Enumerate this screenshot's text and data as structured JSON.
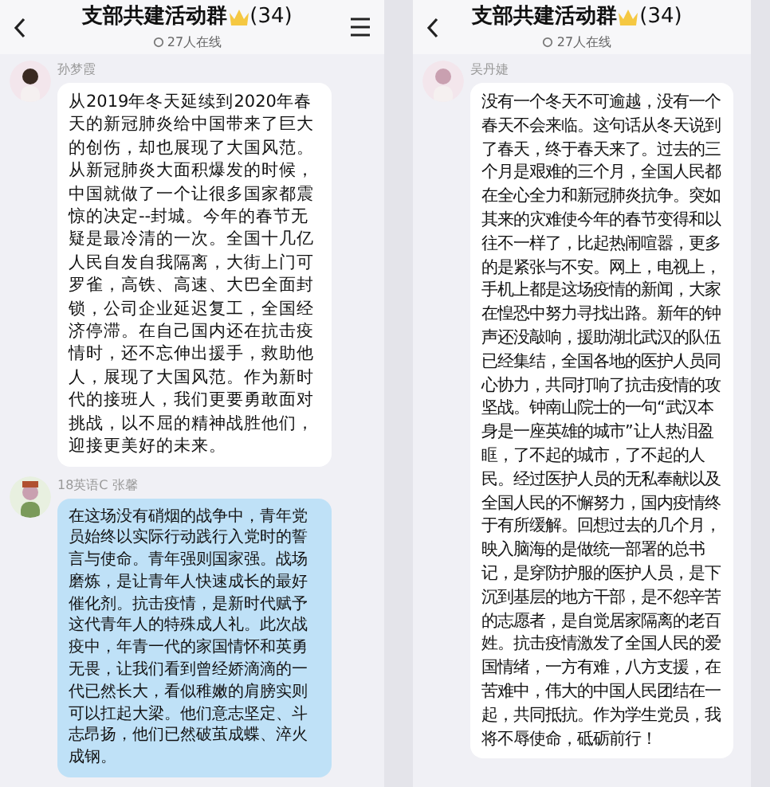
{
  "screens": [
    {
      "title": "支部共建活动群",
      "count": "(34)",
      "online": "27人在线",
      "has_menu": true,
      "messages": [
        {
          "sender": "孙梦霞",
          "kind": "plain",
          "text": "从2019年冬天延续到2020年春天的新冠肺炎给中国带来了巨大的创伤，却也展现了大国风范。从新冠肺炎大面积爆发的时候，中国就做了一个让很多国家都震惊的决定--封城。今年的春节无疑是最冷清的一次。全国十几亿人民自发自我隔离，大街上门可罗雀，高铁、高速、大巴全面封锁，公司企业延迟复工，全国经济停滞。在自己国内还在抗击疫情时，还不忘伸出援手，救助他人，展现了大国风范。作为新时代的接班人，我们更要勇敢面对挑战，以不屈的精神战胜他们，迎接更美好的未来。"
        },
        {
          "sender": "18英语C 张馨",
          "kind": "styled",
          "text": "在这场没有硝烟的战争中，青年党员始终以实际行动践行入党时的誓言与使命。青年强则国家强。战场磨炼，是让青年人快速成长的最好催化剂。抗击疫情，是新时代赋予这代青年人的特殊成人礼。此次战疫中，年青一代的家国情怀和英勇无畏，让我们看到曾经娇滴滴的一代已然长大，看似稚嫩的肩膀实则可以扛起大梁。他们意志坚定、斗志昂扬，他们已然破茧成蝶、淬火成钢。"
        }
      ]
    },
    {
      "title": "支部共建活动群",
      "count": "(34)",
      "online": "27人在线",
      "has_menu": false,
      "messages": [
        {
          "sender": "吴丹婕",
          "kind": "plain",
          "text": "没有一个冬天不可逾越，没有一个春天不会来临。这句话从冬天说到了春天，终于春天来了。过去的三个月是艰难的三个月，全国人民都在全心全力和新冠肺炎抗争。突如其来的灾难使今年的春节变得和以往不一样了，比起热闹喧嚣，更多的是紧张与不安。网上，电视上，手机上都是这场疫情的新闻，大家在惶恐中努力寻找出路。新年的钟声还没敲响，援助湖北武汉的队伍已经集结，全国各地的医护人员同心协力，共同打响了抗击疫情的攻坚战。钟南山院士的一句“武汉本身是一座英雄的城市”让人热泪盈眶，了不起的城市，了不起的人民。经过医护人员的无私奉献以及全国人民的不懈努力，国内疫情终于有所缓解。回想过去的几个月，映入脑海的是做统一部署的总书记，是穿防护服的医护人员，是下沉到基层的地方干部，是不怨辛苦的志愿者，是自觉居家隔离的老百姓。抗击疫情激发了全国人民的爱国情绪，一方有难，八方支援，在苦难中，伟大的中国人民团结在一起，共同抵抗。作为学生党员，我将不辱使命，砥砺前行！"
        }
      ]
    }
  ]
}
